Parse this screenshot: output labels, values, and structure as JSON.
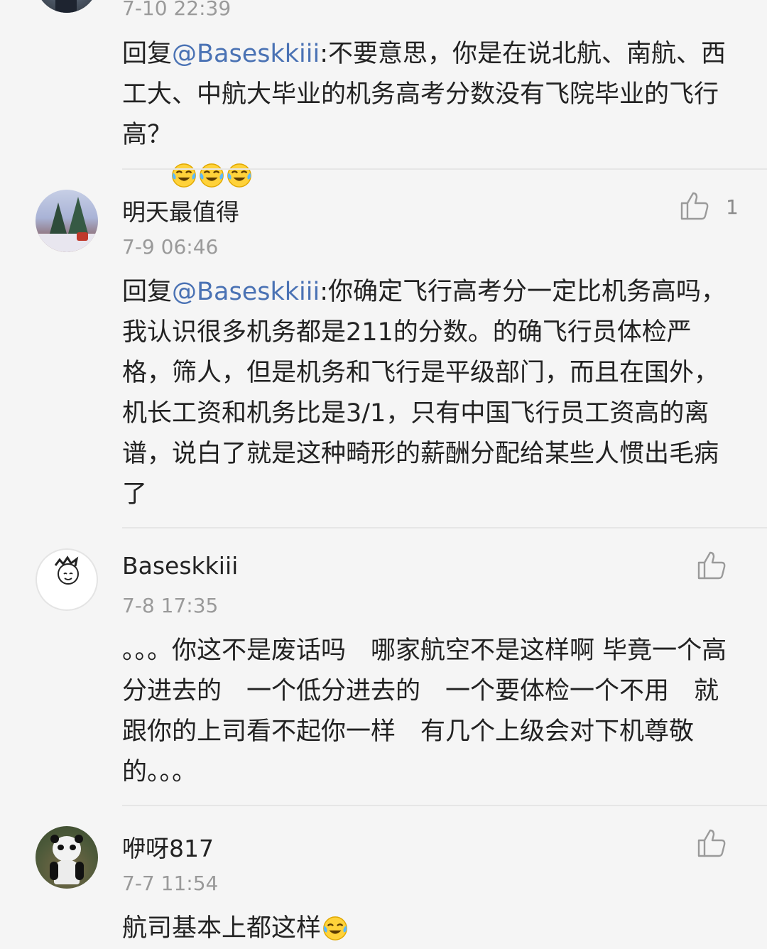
{
  "comments": [
    {
      "time": "7-10 22:39",
      "reply_prefix": "回复",
      "mention": "@Baseskkiii",
      "text": ":不要意思，你是在说北航、南航、西工大、中航大毕业的机务高考分数没有飞院毕业的飞行高？",
      "emoji": "laugh-cry-emoji"
    },
    {
      "username": "明天最值得",
      "time": "7-9 06:46",
      "like_count": "1",
      "reply_prefix": "回复",
      "mention": "@Baseskkiii",
      "text": ":你确定飞行高考分一定比机务高吗，我认识很多机务都是211的分数。的确飞行员体检严格，筛人，但是机务和飞行是平级部门，而且在国外，机长工资和机务比是3/1，只有中国飞行员工资高的离谱，说白了就是这种畸形的薪酬分配给某些人惯出毛病了"
    },
    {
      "username": "Baseskkiii",
      "time": "7-8 17:35",
      "text": "。。。你这不是废话吗　哪家航空不是这样啊 毕竟一个高分进去的　一个低分进去的　一个要体检一个不用　就跟你的上司看不起你一样　有几个上级会对下机尊敬的。。。"
    },
    {
      "username": "咿呀817",
      "time": "7-7 11:54",
      "text": "航司基本上都这样",
      "emoji": "laugh-cry-emoji"
    }
  ],
  "icons": {
    "like": "thumbs-up-icon"
  },
  "colors": {
    "mention": "#4a72b4",
    "background": "#f5f5f5",
    "meta": "#9a9a9a"
  }
}
